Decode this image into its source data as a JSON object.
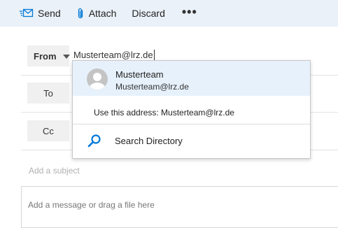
{
  "toolbar": {
    "send_label": "Send",
    "attach_label": "Attach",
    "discard_label": "Discard",
    "more_label": "•••",
    "accent_color": "#0078d7"
  },
  "compose": {
    "from_label": "From",
    "from_value": "Musterteam@lrz.de",
    "to_label": "To",
    "cc_label": "Cc",
    "subject_placeholder": "Add a subject",
    "message_placeholder": "Add a message or drag a file here"
  },
  "autocomplete": {
    "suggestions": [
      {
        "name": "Musterteam",
        "email": "Musterteam@lrz.de"
      }
    ],
    "use_address_text": "Use this address: Musterteam@lrz.de",
    "search_directory_label": "Search Directory",
    "highlight_color": "#e6f1fb"
  }
}
